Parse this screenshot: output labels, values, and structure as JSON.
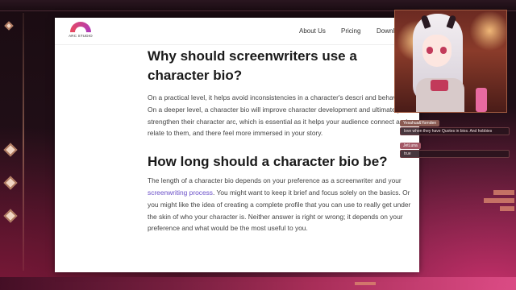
{
  "site": {
    "logo_text": "ARC STUDIO",
    "nav": [
      "About Us",
      "Pricing",
      "Downl"
    ]
  },
  "article": {
    "heading_1": "Why should screenwriters use a character bio?",
    "paragraph_1": "On a practical level, it helps avoid inconsistencies in a character's descri and behaviour. On a deeper level, a character bio will improve character development and ultimately strengthen their character arc, which is essential as it helps your audience connect and relate to them, and there feel more immersed in your story.",
    "heading_2": "How long should a character bio be?",
    "paragraph_2_before": "The length of a character bio depends on your preference as a screenwriter and your ",
    "paragraph_2_link": "screenwriting process",
    "paragraph_2_after": ". You might want to keep it brief and focus solely on the basics. Or you might like the idea of creating a complete profile that you can use to really get under the skin of who your character is. Neither answer is right or wrong; it depends on your preference and what would be the most useful to you."
  },
  "chat": {
    "messages": [
      {
        "user": "Yesahua&Yornden",
        "text": "love when they have Quotes in bios. And hobbies"
      },
      {
        "user": "JetLuna",
        "text": "true"
      }
    ]
  },
  "colors": {
    "link": "#6a4fc8",
    "accent": "#c4306a"
  }
}
